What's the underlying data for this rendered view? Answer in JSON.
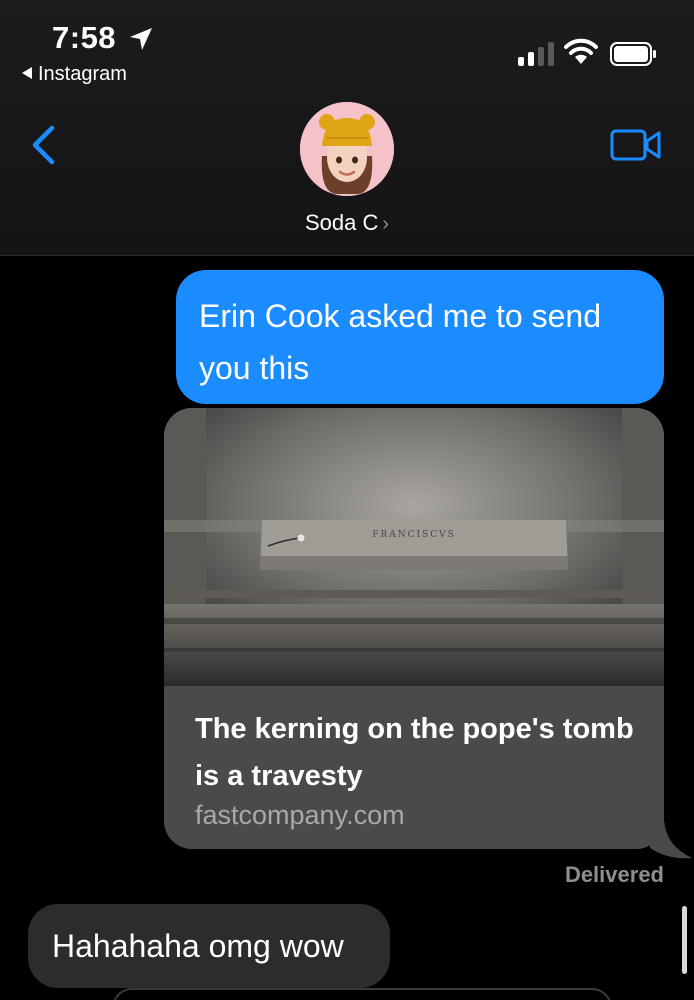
{
  "status_bar": {
    "time": "7:58",
    "back_app_label": "Instagram",
    "signal_bars_filled": 2,
    "signal_bars_total": 4
  },
  "nav": {
    "contact_name": "Soda C",
    "chevron": "›",
    "back_icon": "chevron-left-icon",
    "video_icon": "video-camera-icon"
  },
  "messages": {
    "outgoing_text_line1": "Erin Cook asked me to send",
    "outgoing_text_line2": "you this",
    "link_preview": {
      "title": "The kerning on the pope's tomb is a travesty",
      "domain": "fastcompany.com",
      "image_inscription": "FRANCISCVS"
    },
    "delivered_label": "Delivered",
    "incoming_text": "Hahahaha omg wow"
  },
  "colors": {
    "accent_blue": "#1a8cff",
    "incoming_bubble": "#2c2c2e",
    "link_meta_bg": "#4a4a4d",
    "muted_text": "#8e8e93"
  }
}
